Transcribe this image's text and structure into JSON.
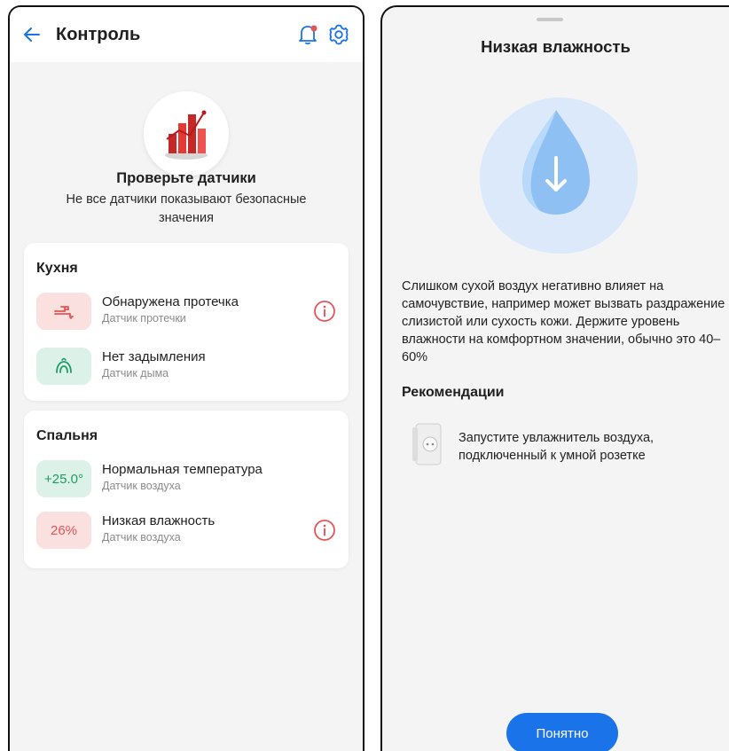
{
  "left": {
    "header": {
      "title": "Контроль"
    },
    "hero": {
      "title": "Проверьте датчики",
      "subtitle": "Не все датчики показывают безопасные значения"
    },
    "rooms": [
      {
        "name": "Кухня",
        "sensors": [
          {
            "badge_icon": "faucet-icon",
            "label": "Обнаружена протечка",
            "sub": "Датчик протечки",
            "status": "alert"
          },
          {
            "badge_icon": "smoke-icon",
            "label": "Нет задымления",
            "sub": "Датчик дыма",
            "status": "ok"
          }
        ]
      },
      {
        "name": "Спальня",
        "sensors": [
          {
            "value": "+25.0°",
            "label": "Нормальная температура",
            "sub": "Датчик воздуха",
            "status": "ok"
          },
          {
            "value": "26%",
            "label": "Низкая влажность",
            "sub": "Датчик воздуха",
            "status": "alert"
          }
        ]
      }
    ]
  },
  "right": {
    "title": "Низкая влажность",
    "description": "Слишком сухой воздух негативно влияет на самочувствие, например может вызвать раздражение слизистой или сухость кожи. Держите уровень влажности на комфортном значении, обычно это 40–60%",
    "recommendations_title": "Рекомендации",
    "recommendation": "Запустите увлажнитель воздуха, подключенный к умной розетке",
    "button": "Понятно"
  },
  "colors": {
    "accent": "#1a73e8",
    "alert": "#e35454",
    "alert_bg": "#fbe0e0",
    "ok": "#1f9a63",
    "ok_bg": "#dcf2e8"
  }
}
